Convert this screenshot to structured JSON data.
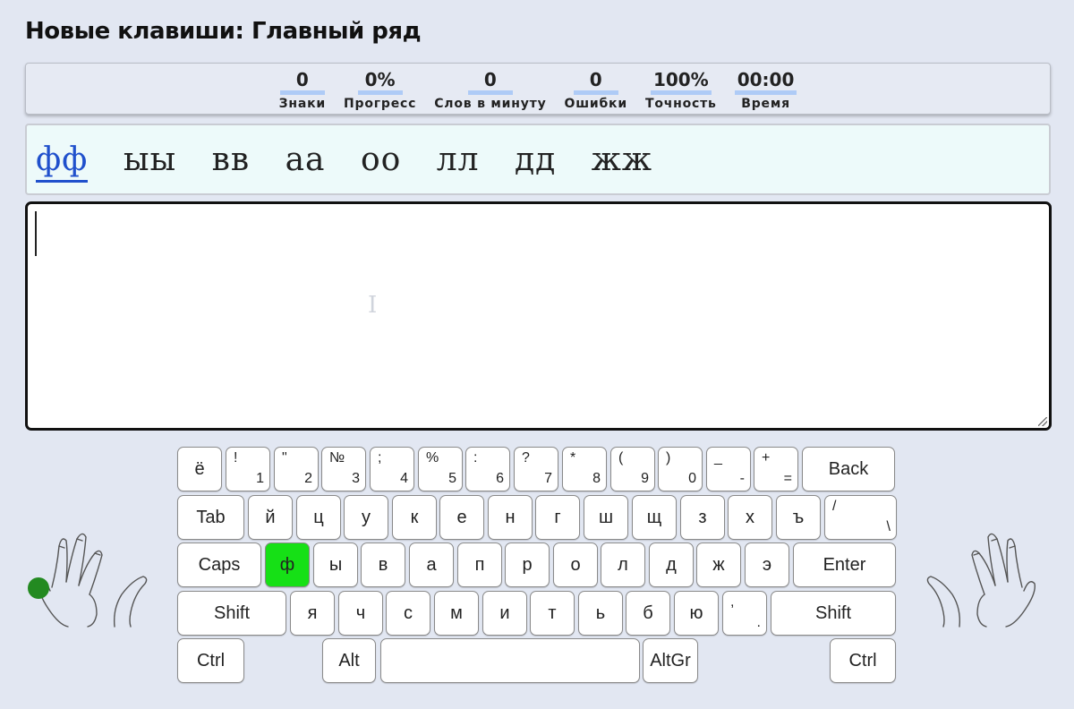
{
  "page": {
    "title": "Новые клавиши: Главный ряд"
  },
  "stats": [
    {
      "value": "0",
      "label": "Знаки"
    },
    {
      "value": "0%",
      "label": "Прогресс"
    },
    {
      "value": "0",
      "label": "Слов в минуту"
    },
    {
      "value": "0",
      "label": "Ошибки"
    },
    {
      "value": "100%",
      "label": "Точность"
    },
    {
      "value": "00:00",
      "label": "Время"
    }
  ],
  "lesson": {
    "words": [
      "фф",
      "ыы",
      "вв",
      "аа",
      "оо",
      "лл",
      "дд",
      "жж"
    ],
    "current_index": 0
  },
  "input": {
    "value": ""
  },
  "keyboard": {
    "highlight_color": "#16e016",
    "finger_dot_color": "#238a21",
    "highlighted_key": "ф",
    "rows": [
      [
        {
          "label": "ё"
        },
        {
          "top": "!",
          "bot": "1"
        },
        {
          "top": "\"",
          "bot": "2"
        },
        {
          "top": "№",
          "bot": "3"
        },
        {
          "top": ";",
          "bot": "4"
        },
        {
          "top": "%",
          "bot": "5"
        },
        {
          "top": ":",
          "bot": "6"
        },
        {
          "top": "?",
          "bot": "7"
        },
        {
          "top": "*",
          "bot": "8"
        },
        {
          "top": "(",
          "bot": "9"
        },
        {
          "top": ")",
          "bot": "0"
        },
        {
          "top": "_",
          "bot": "-"
        },
        {
          "top": "+",
          "bot": "="
        },
        {
          "label": "Back"
        }
      ],
      [
        {
          "label": "Tab"
        },
        {
          "label": "й"
        },
        {
          "label": "ц"
        },
        {
          "label": "у"
        },
        {
          "label": "к"
        },
        {
          "label": "е"
        },
        {
          "label": "н"
        },
        {
          "label": "г"
        },
        {
          "label": "ш"
        },
        {
          "label": "щ"
        },
        {
          "label": "з"
        },
        {
          "label": "х"
        },
        {
          "label": "ъ"
        },
        {
          "top": "/",
          "bot": "\\"
        }
      ],
      [
        {
          "label": "Caps"
        },
        {
          "label": "ф"
        },
        {
          "label": "ы"
        },
        {
          "label": "в"
        },
        {
          "label": "а"
        },
        {
          "label": "п"
        },
        {
          "label": "р"
        },
        {
          "label": "о"
        },
        {
          "label": "л"
        },
        {
          "label": "д"
        },
        {
          "label": "ж"
        },
        {
          "label": "э"
        },
        {
          "label": "Enter"
        }
      ],
      [
        {
          "label": "Shift"
        },
        {
          "label": "я"
        },
        {
          "label": "ч"
        },
        {
          "label": "с"
        },
        {
          "label": "м"
        },
        {
          "label": "и"
        },
        {
          "label": "т"
        },
        {
          "label": "ь"
        },
        {
          "label": "б"
        },
        {
          "label": "ю"
        },
        {
          "top": ",",
          "bot": "."
        },
        {
          "label": "Shift"
        }
      ],
      [
        {
          "label": "Ctrl"
        },
        {
          "label": "Alt"
        },
        {
          "label": ""
        },
        {
          "label": "AltGr"
        },
        {
          "label": "Ctrl"
        }
      ]
    ]
  }
}
